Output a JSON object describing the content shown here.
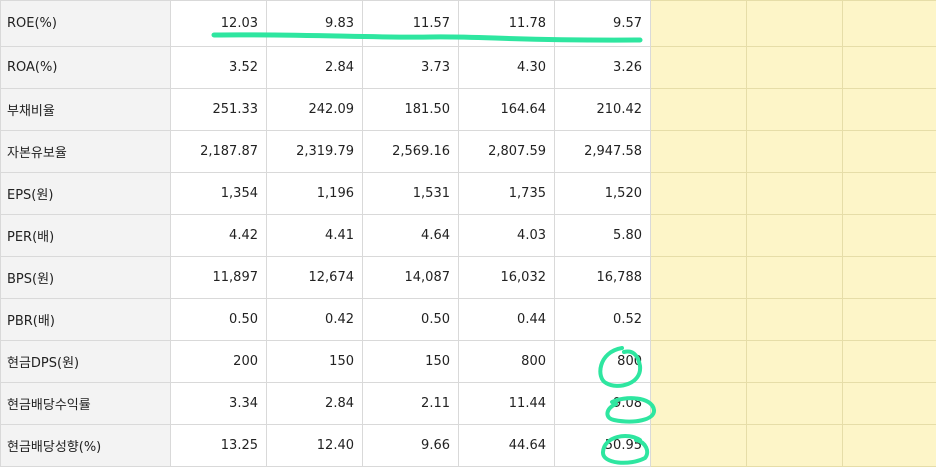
{
  "rows": [
    {
      "label": "ROE(%)",
      "values": [
        "12.03",
        "9.83",
        "11.57",
        "11.78",
        "9.57"
      ]
    },
    {
      "label": "ROA(%)",
      "values": [
        "3.52",
        "2.84",
        "3.73",
        "4.30",
        "3.26"
      ]
    },
    {
      "label": "부채비율",
      "values": [
        "251.33",
        "242.09",
        "181.50",
        "164.64",
        "210.42"
      ]
    },
    {
      "label": "자본유보율",
      "values": [
        "2,187.87",
        "2,319.79",
        "2,569.16",
        "2,807.59",
        "2,947.58"
      ]
    },
    {
      "label": "EPS(원)",
      "values": [
        "1,354",
        "1,196",
        "1,531",
        "1,735",
        "1,520"
      ]
    },
    {
      "label": "PER(배)",
      "values": [
        "4.42",
        "4.41",
        "4.64",
        "4.03",
        "5.80"
      ]
    },
    {
      "label": "BPS(원)",
      "values": [
        "11,897",
        "12,674",
        "14,087",
        "16,032",
        "16,788"
      ]
    },
    {
      "label": "PBR(배)",
      "values": [
        "0.50",
        "0.42",
        "0.50",
        "0.44",
        "0.52"
      ]
    },
    {
      "label": "현금DPS(원)",
      "values": [
        "200",
        "150",
        "150",
        "800",
        "800"
      ]
    },
    {
      "label": "현금배당수익률",
      "values": [
        "3.34",
        "2.84",
        "2.11",
        "11.44",
        "9.08"
      ]
    },
    {
      "label": "현금배당성향(%)",
      "values": [
        "13.25",
        "12.40",
        "9.66",
        "44.64",
        "50.95"
      ]
    }
  ],
  "highlight_color": "#2ee6a0",
  "empty_cell_color": "#fdf5c8"
}
